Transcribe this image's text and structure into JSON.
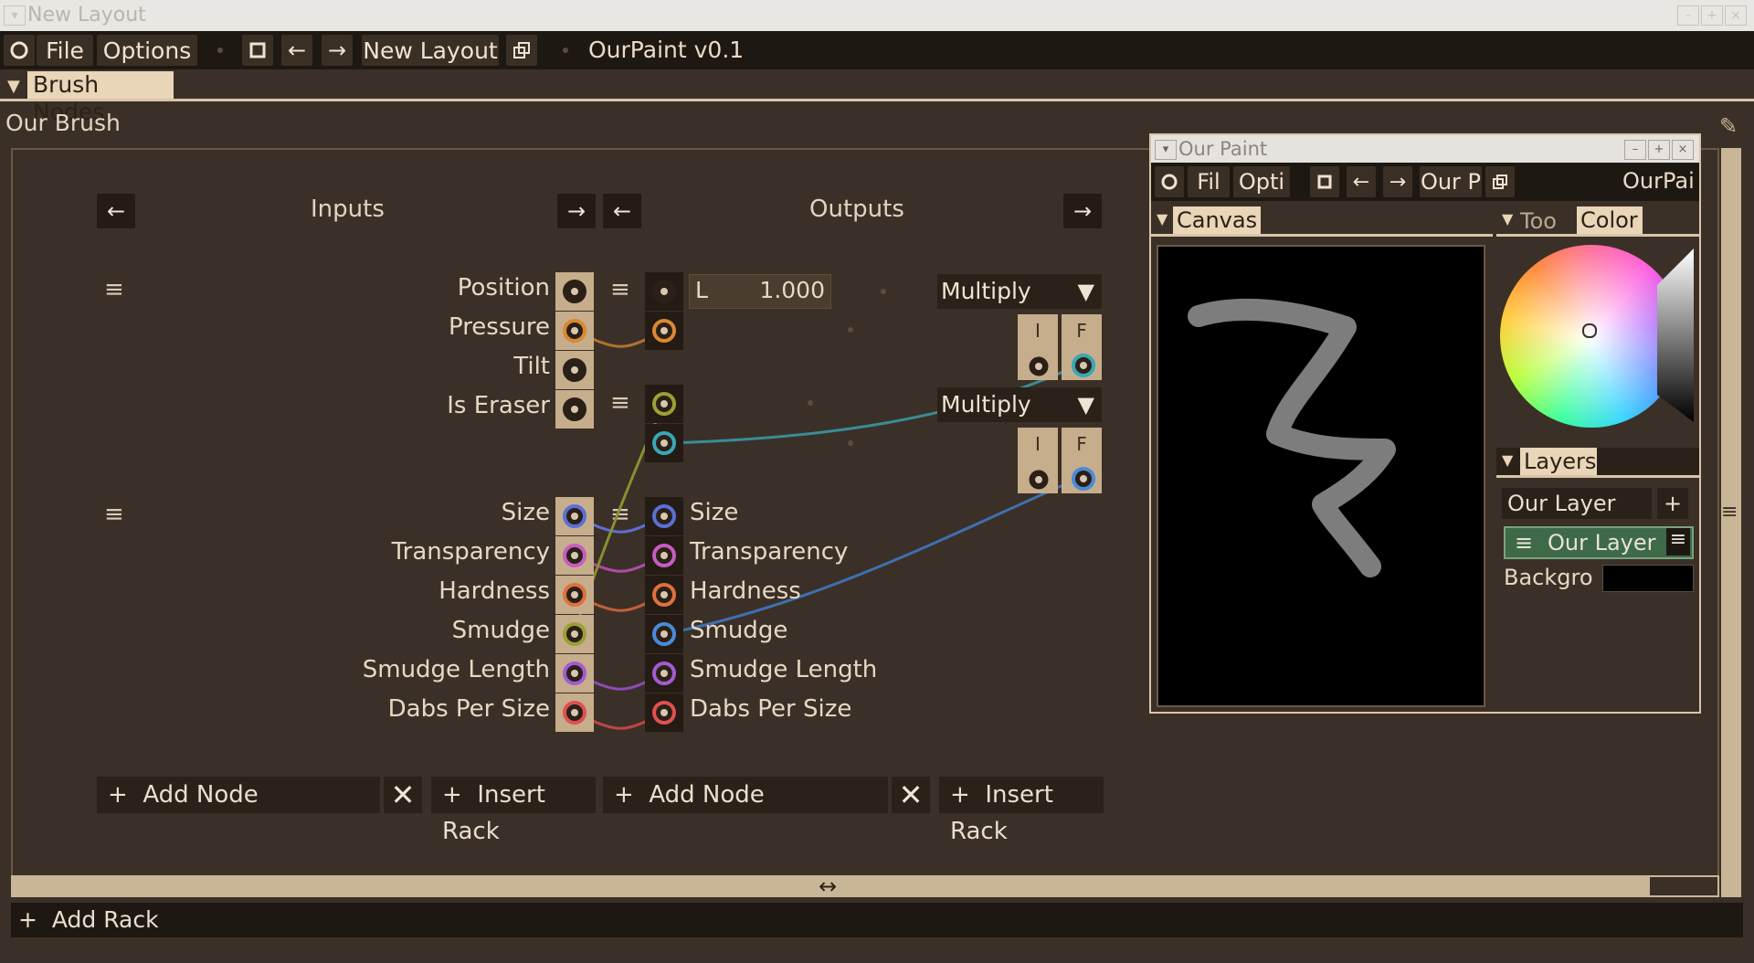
{
  "window": {
    "title": "New Layout"
  },
  "menubar": {
    "file": "File",
    "options": "Options",
    "layout_name": "New Layout",
    "app_label": "OurPaint v0.1"
  },
  "brush_nodes": {
    "tab_label": "Brush Nodes",
    "brush_name": "Our Brush"
  },
  "racks": {
    "inputs_title": "Inputs",
    "outputs_title": "Outputs",
    "inputs": [
      "Position",
      "Pressure",
      "Tilt",
      "Is Eraser",
      "Size",
      "Transparency",
      "Hardness",
      "Smudge",
      "Smudge Length",
      "Dabs Per Size"
    ],
    "outputs": [
      "Size",
      "Transparency",
      "Hardness",
      "Smudge",
      "Smudge Length",
      "Dabs Per Size"
    ],
    "value_field": {
      "label": "L",
      "value": "1.000"
    },
    "multiply_1": "Multiply",
    "multiply_2": "Multiply",
    "cell_i": "I",
    "cell_f": "F",
    "add_node": "Add Node",
    "insert_rack": "Insert Rack",
    "add_rack": "Add Rack"
  },
  "our_paint_window": {
    "title": "Our Paint",
    "menu": {
      "file": "Fil",
      "options": "Opti",
      "layout": "Our P",
      "app": "OurPai"
    },
    "canvas_tab": "Canvas",
    "tools_tab": "Too",
    "color_tab": "Color",
    "layers_tab": "Layers",
    "layers": {
      "new_layer_name": "Our Layer",
      "selected_layer": "Our Layer",
      "background_label": "Backgro"
    }
  },
  "socket_colors": {
    "Position": "#2a2018",
    "Pressure": "#d9892f",
    "Tilt": "#2a2018",
    "Is Eraser": "#2a2018",
    "Size": "#5b6fd6",
    "Transparency": "#c85cc0",
    "Hardness": "#e0703f",
    "Smudge": "#9ca035",
    "Smudge Length": "#a35bd0",
    "Dabs Per Size": "#e05050"
  }
}
